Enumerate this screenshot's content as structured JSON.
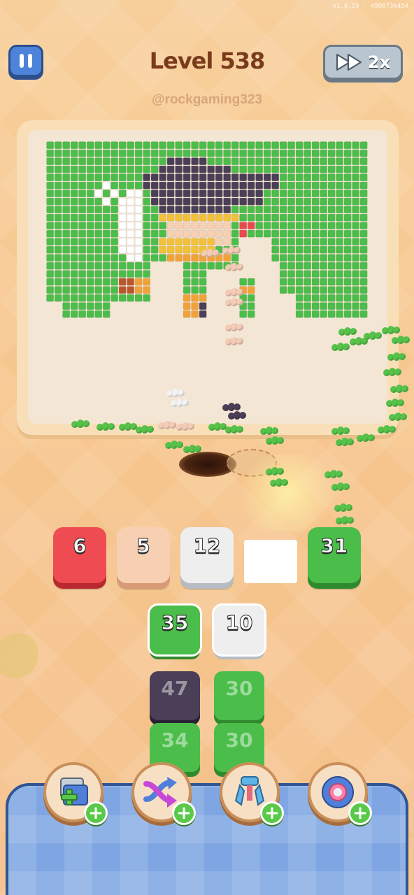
{
  "header": {
    "version": "v1.0.59 - 4908736454",
    "level_title": "Level 538",
    "username": "@rockgaming323",
    "speed_label": "2x"
  },
  "colors": {
    "red": "#ef4b52",
    "peach": "#f7d0b3",
    "white": "#eeeeee",
    "green": "#4bbd4a",
    "dark": "#4a3f56",
    "yellow": "#f2c13a",
    "orange": "#f0a238",
    "brown": "#b9572c"
  },
  "slots": [
    {
      "value": "6",
      "color": "red"
    },
    {
      "value": "5",
      "color": "peach"
    },
    {
      "value": "12",
      "color": "white"
    },
    {
      "value": "",
      "color": "empty"
    },
    {
      "value": "31",
      "color": "green"
    }
  ],
  "queue": [
    {
      "value": "35",
      "color": "green",
      "active": true
    },
    {
      "value": "10",
      "color": "white",
      "active": true
    },
    {
      "value": "47",
      "color": "dark",
      "active": false
    },
    {
      "value": "30",
      "color": "green",
      "active": false
    },
    {
      "value": "34",
      "color": "green",
      "active": false
    },
    {
      "value": "30",
      "color": "green",
      "active": false
    }
  ],
  "boosters": [
    {
      "name": "add-box-booster"
    },
    {
      "name": "shuffle-booster"
    },
    {
      "name": "magnet-claw-booster"
    },
    {
      "name": "hint-eye-booster"
    }
  ]
}
